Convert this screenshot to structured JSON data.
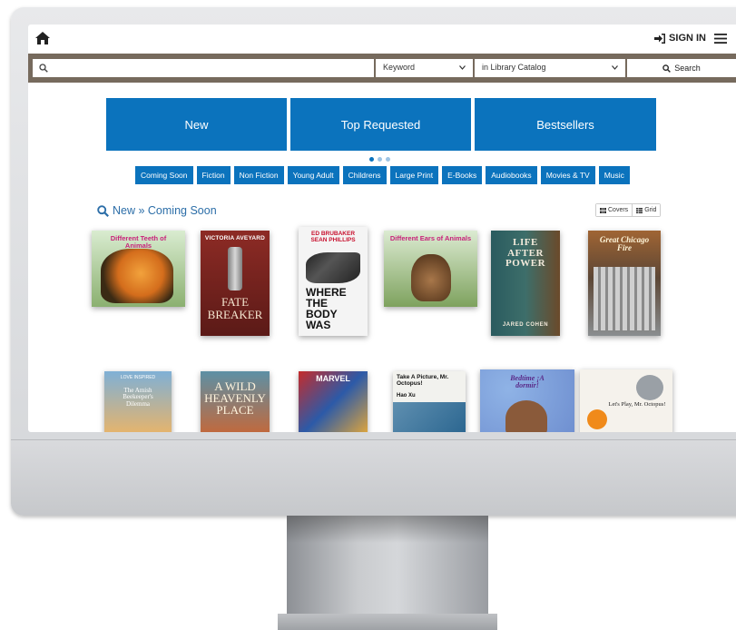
{
  "header": {
    "signin_label": "SIGN IN"
  },
  "search": {
    "input_value": "",
    "search_type": "Keyword",
    "scope": "in Library Catalog",
    "button_label": "Search"
  },
  "tiles": [
    {
      "label": "New"
    },
    {
      "label": "Top Requested"
    },
    {
      "label": "Bestsellers"
    }
  ],
  "carousel": {
    "page": 1,
    "pages": 3
  },
  "categories": [
    {
      "label": "Coming Soon"
    },
    {
      "label": "Fiction"
    },
    {
      "label": "Non Fiction"
    },
    {
      "label": "Young Adult"
    },
    {
      "label": "Childrens"
    },
    {
      "label": "Large Print"
    },
    {
      "label": "E-Books"
    },
    {
      "label": "Audiobooks"
    },
    {
      "label": "Movies & TV"
    },
    {
      "label": "Music"
    }
  ],
  "section": {
    "heading": "New » Coming Soon",
    "view_covers": "Covers",
    "view_grid": "Grid"
  },
  "books_row1": [
    {
      "title": "Different Teeth of Animals",
      "author": ""
    },
    {
      "title": "FATE BREAKER",
      "author": "VICTORIA AVEYARD"
    },
    {
      "title": "WHERE THE BODY WAS",
      "author": "ED BRUBAKER SEAN PHILLIPS"
    },
    {
      "title": "Different Ears of Animals",
      "author": ""
    },
    {
      "title": "LIFE AFTER POWER",
      "author": "JARED COHEN"
    },
    {
      "title": "Great Chicago Fire",
      "author": ""
    }
  ],
  "books_row2": [
    {
      "title": "The Amish Beekeeper's Dilemma",
      "author": "LOVE INSPIRED"
    },
    {
      "title": "A WILD HEAVENLY PLACE",
      "author": ""
    },
    {
      "title": "MARVEL",
      "author": ""
    },
    {
      "title": "Take A Picture, Mr. Octopus!",
      "author": "Hao Xu"
    },
    {
      "title": "Bedtime ¡A dormir!",
      "author": ""
    },
    {
      "title": "Let's Play, Mr. Octopus!",
      "author": ""
    }
  ],
  "colors": {
    "accent": "#0b73bd",
    "searchbar": "#766a5d",
    "heading": "#2c6ea8"
  }
}
